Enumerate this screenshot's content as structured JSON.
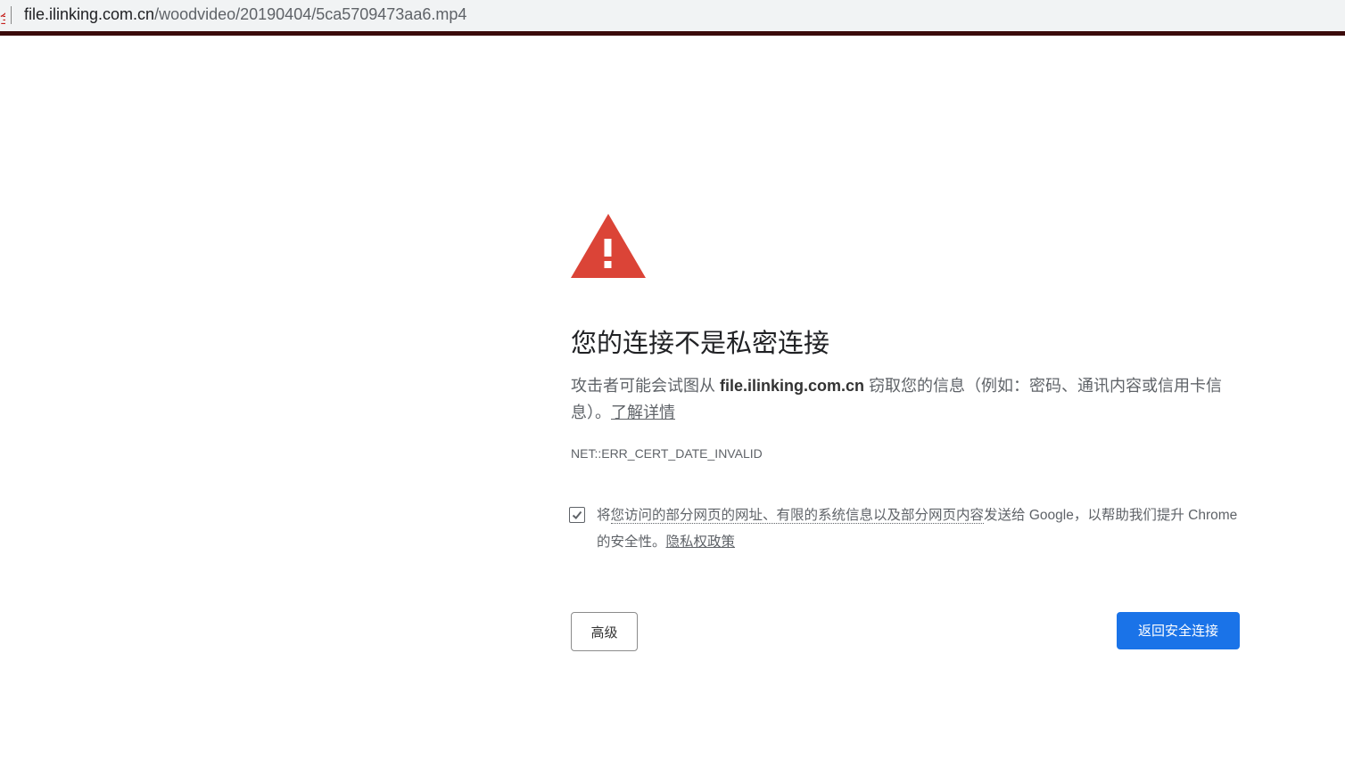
{
  "browser": {
    "security_fragment": "全",
    "url_host": "file.ilinking.com.cn",
    "url_path": "/woodvideo/20190404/5ca5709473aa6.mp4"
  },
  "colors": {
    "warning_red": "#db4437",
    "primary_blue": "#1a73e8",
    "top_line": "#3a0a0a"
  },
  "interstitial": {
    "icon": "warning-triangle-icon",
    "title": "您的连接不是私密连接",
    "desc_prefix": "攻击者可能会试图从",
    "desc_host": "file.ilinking.com.cn",
    "desc_suffix": "窃取您的信息（例如：密码、通讯内容或信用卡信息）。",
    "learn_more": "了解详情",
    "error_code": "NET::ERR_CERT_DATE_INVALID",
    "optin_prefix": "将",
    "optin_linked": "您访问的部分网页的网址、有限的系统信息以及部分网页内容",
    "optin_suffix": "发送给 Google，以帮助我们提升 Chrome 的安全性。",
    "privacy_link": "隐私权政策",
    "optin_checked": true,
    "advanced_button": "高级",
    "back_button": "返回安全连接"
  }
}
